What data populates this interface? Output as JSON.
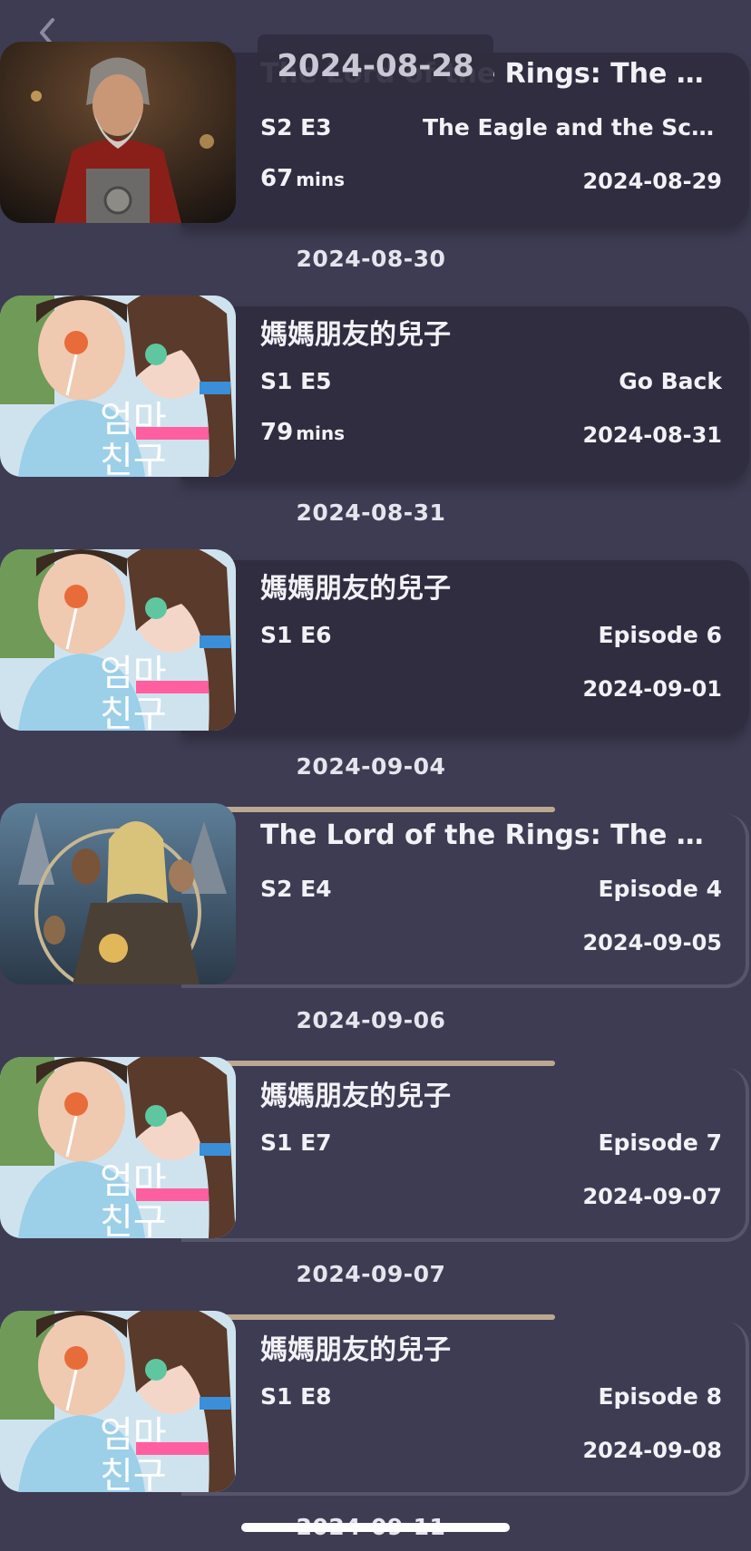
{
  "nav": {
    "back_icon": "chevron-left-icon"
  },
  "sticky_date": "2024-08-28",
  "entries": [
    {
      "title": "The Lord of the Rings: The Rings of Power",
      "episode": "S2 E3",
      "episode_name": "The Eagle and the Scepter",
      "duration_value": "67",
      "duration_unit": "mins",
      "air_date": "2024-08-29",
      "poster": "rings-of-power-character-poster"
    },
    {
      "date_header": "2024-08-30",
      "title": "媽媽朋友的兒子",
      "episode": "S1 E5",
      "episode_name": "Go Back",
      "duration_value": "79",
      "duration_unit": "mins",
      "air_date": "2024-08-31",
      "poster": "love-next-door-poster"
    },
    {
      "date_header": "2024-08-31",
      "title": "媽媽朋友的兒子",
      "episode": "S1 E6",
      "episode_name": "Episode 6",
      "air_date": "2024-09-01",
      "poster": "love-next-door-poster"
    },
    {
      "date_header": "2024-09-04",
      "title": "The Lord of the Rings: The Rings of Power",
      "episode": "S2 E4",
      "episode_name": "Episode 4",
      "air_date": "2024-09-05",
      "poster": "rings-of-power-group-poster"
    },
    {
      "date_header": "2024-09-06",
      "title": "媽媽朋友的兒子",
      "episode": "S1 E7",
      "episode_name": "Episode 7",
      "air_date": "2024-09-07",
      "poster": "love-next-door-poster"
    },
    {
      "date_header": "2024-09-07",
      "title": "媽媽朋友的兒子",
      "episode": "S1 E8",
      "episode_name": "Episode 8",
      "air_date": "2024-09-08",
      "poster": "love-next-door-poster"
    }
  ],
  "next_date_header": "2024-09-11",
  "colors": {
    "background": "#3e3c52",
    "card": "#2f2d3f",
    "progress": "#bba891"
  }
}
